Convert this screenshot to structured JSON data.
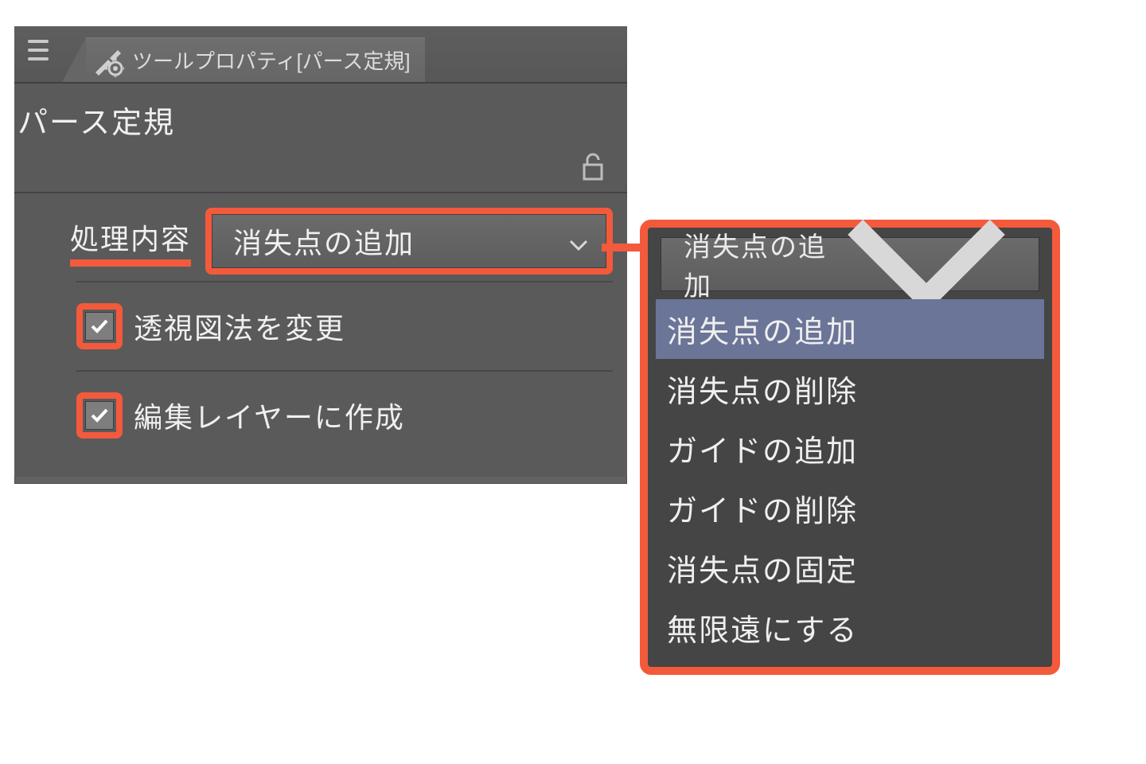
{
  "panel": {
    "tab_title": "ツールプロパティ[パース定規]",
    "tool_name": "パース定規",
    "property_label": "処理内容",
    "dropdown_value": "消失点の追加",
    "checkbox1_label": "透視図法を変更",
    "checkbox2_label": "編集レイヤーに作成"
  },
  "dropdown": {
    "current": "消失点の追加",
    "options": [
      "消失点の追加",
      "消失点の削除",
      "ガイドの追加",
      "ガイドの削除",
      "消失点の固定",
      "無限遠にする"
    ],
    "selected_index": 0
  }
}
